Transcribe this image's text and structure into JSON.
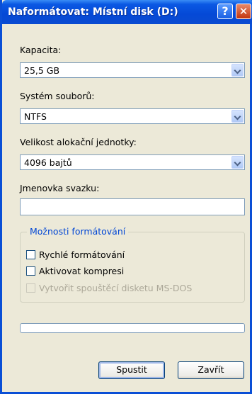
{
  "window": {
    "title": "Naformátovat: Místní disk (D:)",
    "help_glyph": "?",
    "close_glyph": "✕"
  },
  "capacity": {
    "label": "Kapacita:",
    "value": "25,5 GB"
  },
  "filesystem": {
    "label": "Systém souborů:",
    "value": "NTFS"
  },
  "allocation": {
    "label": "Velikost alokační jednotky:",
    "value": "4096 bajtů"
  },
  "volume_label": {
    "label": "Jmenovka svazku:",
    "value": ""
  },
  "options": {
    "title": "Možnosti formátování",
    "quick_format": {
      "label": "Rychlé formátování",
      "checked": false
    },
    "enable_compression": {
      "label": "Aktivovat kompresi",
      "checked": false
    },
    "msdos_startup": {
      "label": "Vytvořit spouštěcí disketu MS-DOS",
      "checked": false,
      "disabled": true
    }
  },
  "progress": {
    "value": 0
  },
  "buttons": {
    "start": "Spustit",
    "close": "Zavřít"
  },
  "colors": {
    "titlebar": "#0a4bd1",
    "window_bg": "#ece9d8",
    "group_title": "#0046d5"
  }
}
